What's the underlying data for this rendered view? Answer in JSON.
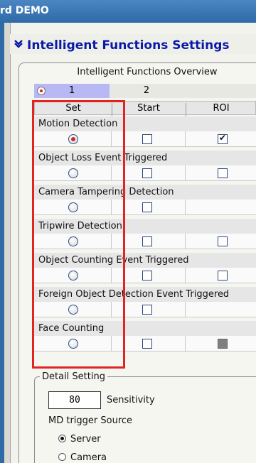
{
  "window": {
    "title": "rd DEMO"
  },
  "header": {
    "title": "Intelligent Functions Settings"
  },
  "overview": {
    "title": "Intelligent Functions Overview"
  },
  "tabs": [
    {
      "label": "1",
      "selected": true
    },
    {
      "label": "2",
      "selected": false
    }
  ],
  "columns": {
    "set": "Set",
    "start": "Start",
    "roi": "ROI"
  },
  "functions": [
    {
      "label": "Motion Detection",
      "set_selected": true,
      "start": false,
      "roi": true,
      "roi_visible": true
    },
    {
      "label": "Object Loss Event Triggered",
      "set_selected": false,
      "start": false,
      "roi": false,
      "roi_visible": true
    },
    {
      "label": "Camera Tampering Detection",
      "set_selected": false,
      "start": false,
      "roi_visible": false
    },
    {
      "label": "Tripwire Detection",
      "set_selected": false,
      "start": false,
      "roi": false,
      "roi_visible": true
    },
    {
      "label": "Object Counting Event Triggered",
      "set_selected": false,
      "start": false,
      "roi": false,
      "roi_visible": true
    },
    {
      "label": "Foreign Object Detection Event Triggered",
      "set_selected": false,
      "start": false,
      "roi_visible": false
    },
    {
      "label": "Face Counting",
      "set_selected": false,
      "start": false,
      "roi": false,
      "roi_visible": true,
      "roi_disabled": true
    }
  ],
  "detail": {
    "title": "Detail Setting",
    "sensitivity_value": "80",
    "sensitivity_label": "Sensitivity",
    "md_trigger_label": "MD trigger Source",
    "sources": [
      {
        "label": "Server",
        "selected": true
      },
      {
        "label": "Camera",
        "selected": false
      }
    ]
  },
  "colors": {
    "title_bar": "#3a78b8",
    "header_text": "#0a1aa8",
    "selected_tab": "#b8b8f4",
    "highlight": "#e32222"
  }
}
